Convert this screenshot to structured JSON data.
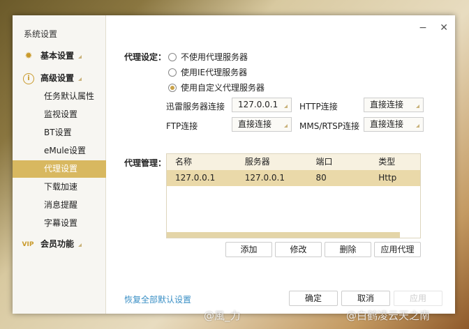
{
  "sidebar": {
    "title": "系统设置",
    "items": [
      {
        "label": "基本设置",
        "icon": "gear-icon"
      },
      {
        "label": "高级设置",
        "icon": "info-icon"
      },
      {
        "label": "任务默认属性"
      },
      {
        "label": "监视设置"
      },
      {
        "label": "BT设置"
      },
      {
        "label": "eMule设置"
      },
      {
        "label": "代理设置",
        "active": true
      },
      {
        "label": "下载加速"
      },
      {
        "label": "消息提醒"
      },
      {
        "label": "字幕设置"
      },
      {
        "label": "会员功能",
        "icon": "vip-icon"
      }
    ]
  },
  "window": {
    "minimize": "−",
    "close": "✕"
  },
  "proxy": {
    "label": "代理设定：",
    "options": [
      "不使用代理服务器",
      "使用IE代理服务器",
      "使用自定义代理服务器"
    ],
    "selected": 2,
    "connections": [
      {
        "label": "迅雷服务器连接",
        "value": "127.0.0.1"
      },
      {
        "label": "HTTP连接",
        "value": "直接连接"
      },
      {
        "label": "FTP连接",
        "value": "直接连接"
      },
      {
        "label": "MMS/RTSP连接",
        "value": "直接连接"
      }
    ]
  },
  "manage": {
    "label": "代理管理：",
    "columns": [
      "名称",
      "服务器",
      "端口",
      "类型"
    ],
    "rows": [
      [
        "127.0.0.1",
        "127.0.0.1",
        "80",
        "Http"
      ]
    ],
    "buttons": [
      "添加",
      "修改",
      "删除",
      "应用代理"
    ]
  },
  "footer": {
    "restore": "恢复全部默认设置",
    "ok": "确定",
    "cancel": "取消",
    "apply": "应用"
  },
  "watermarks": [
    "@風_力",
    "@白鹤凌云天之南"
  ],
  "colors": {
    "accent": "#d8b860",
    "link": "#3a8fc5"
  }
}
